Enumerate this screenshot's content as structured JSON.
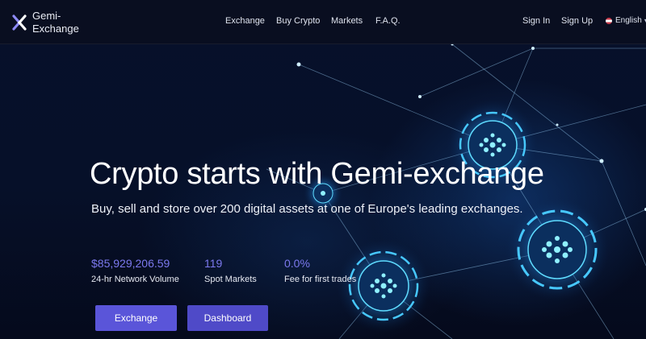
{
  "brand": {
    "name": "Gemi-Exchange",
    "accent_color": "#5a55d9",
    "stat_color": "#7c79ee"
  },
  "nav": {
    "items": [
      {
        "label": "Exchange"
      },
      {
        "label": "Buy Crypto"
      },
      {
        "label": "Markets"
      },
      {
        "label": "F.A.Q."
      }
    ],
    "sign_in": "Sign In",
    "sign_up": "Sign Up",
    "language": "English"
  },
  "hero": {
    "title": "Crypto starts with Gemi-exchange",
    "subtitle": "Buy, sell and store over 200 digital assets at one of Europe's leading exchanges.",
    "stats": [
      {
        "value": "$85,929,206.59",
        "label": "24-hr Network Volume"
      },
      {
        "value": "119",
        "label": "Spot Markets"
      },
      {
        "value": "0.0%",
        "label": "Fee for first trades"
      }
    ],
    "buttons": {
      "exchange": "Exchange",
      "dashboard": "Dashboard"
    }
  }
}
